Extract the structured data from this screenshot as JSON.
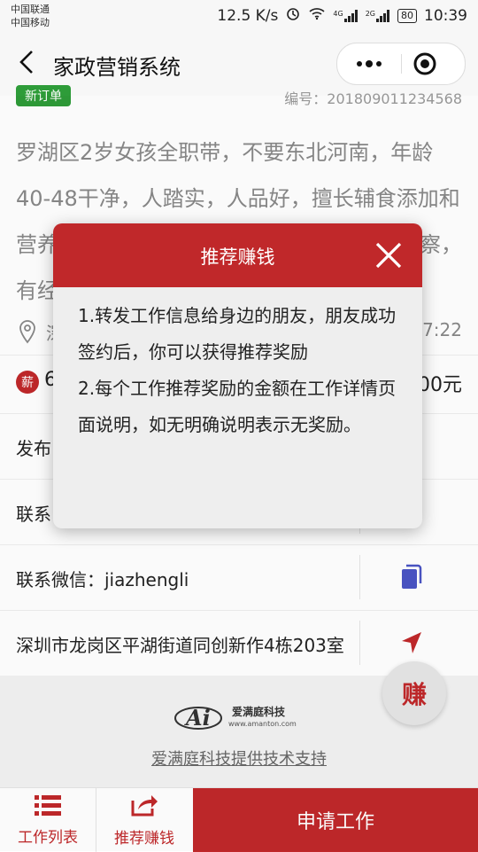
{
  "status_bar": {
    "carrier1": "中国联通",
    "carrier2": "中国移动",
    "speed": "12.5 K/s",
    "battery": "80",
    "time": "10:39",
    "signal_tag": "4G",
    "signal_tag2": "2G"
  },
  "titlebar": {
    "title": "家政营销系统"
  },
  "order": {
    "tag": "新订单",
    "number": "编号：201809011234568",
    "description": "罗湖区2岁女孩全职带，不要东北河南，年龄40-48干净，人踏实，人品好，擅长辅食添加和营养搭配，性格开朗，身体好，会常见病观察，有经",
    "location_visible": "深",
    "time_visible": "17:22",
    "badge": "薪",
    "salary_left": "6",
    "salary_right": "00元"
  },
  "info_rows": [
    {
      "label": "发布"
    },
    {
      "label": "联系"
    },
    {
      "label": "联系微信：jiazhengli"
    },
    {
      "label": "深圳市龙岗区平湖街道同创新作4栋203室"
    }
  ],
  "fab": {
    "label": "赚"
  },
  "footer": {
    "logo_text": "爱满庭科技",
    "logo_url": "www.amanton.com",
    "support": "爱满庭科技提供技术支持"
  },
  "bottom_nav": {
    "job_list": "工作列表",
    "recommend": "推荐赚钱",
    "apply": "申请工作"
  },
  "modal": {
    "title": "推荐赚钱",
    "line1": "1.转发工作信息给身边的朋友，朋友成功签约后，你可以获得推荐奖励",
    "line2": "2.每个工作推荐奖励的金额在工作详情页面说明，如无明确说明表示无奖励。"
  },
  "colors": {
    "brand_red": "#c0282a",
    "tag_green": "#2e9c39",
    "icon_blue": "#4a54c4"
  }
}
